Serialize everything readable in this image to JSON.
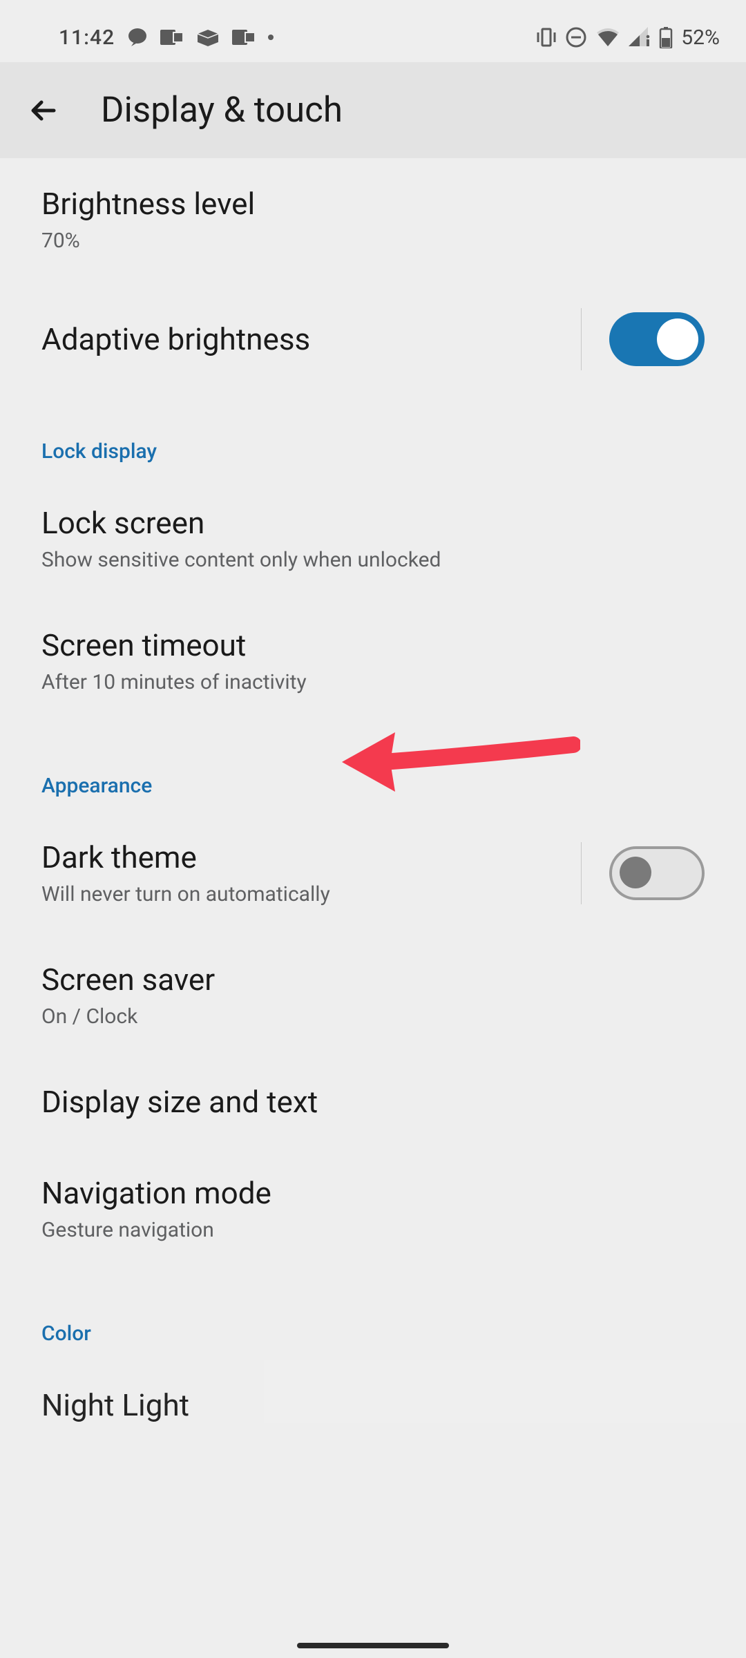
{
  "status": {
    "time": "11:42",
    "battery_text": "52%"
  },
  "header": {
    "title": "Display & touch"
  },
  "sections": {
    "brightness": {
      "title": "Brightness level",
      "value": "70%"
    },
    "adaptive_brightness": {
      "title": "Adaptive brightness",
      "on": true
    },
    "lock_display_header": "Lock display",
    "lock_screen": {
      "title": "Lock screen",
      "subtitle": "Show sensitive content only when unlocked"
    },
    "screen_timeout": {
      "title": "Screen timeout",
      "subtitle": "After 10 minutes of inactivity"
    },
    "appearance_header": "Appearance",
    "dark_theme": {
      "title": "Dark theme",
      "subtitle": "Will never turn on automatically",
      "on": false
    },
    "screen_saver": {
      "title": "Screen saver",
      "subtitle": "On / Clock"
    },
    "display_size": {
      "title": "Display size and text"
    },
    "navigation_mode": {
      "title": "Navigation mode",
      "subtitle": "Gesture navigation"
    },
    "color_header": "Color",
    "night_light": {
      "title": "Night Light"
    }
  }
}
